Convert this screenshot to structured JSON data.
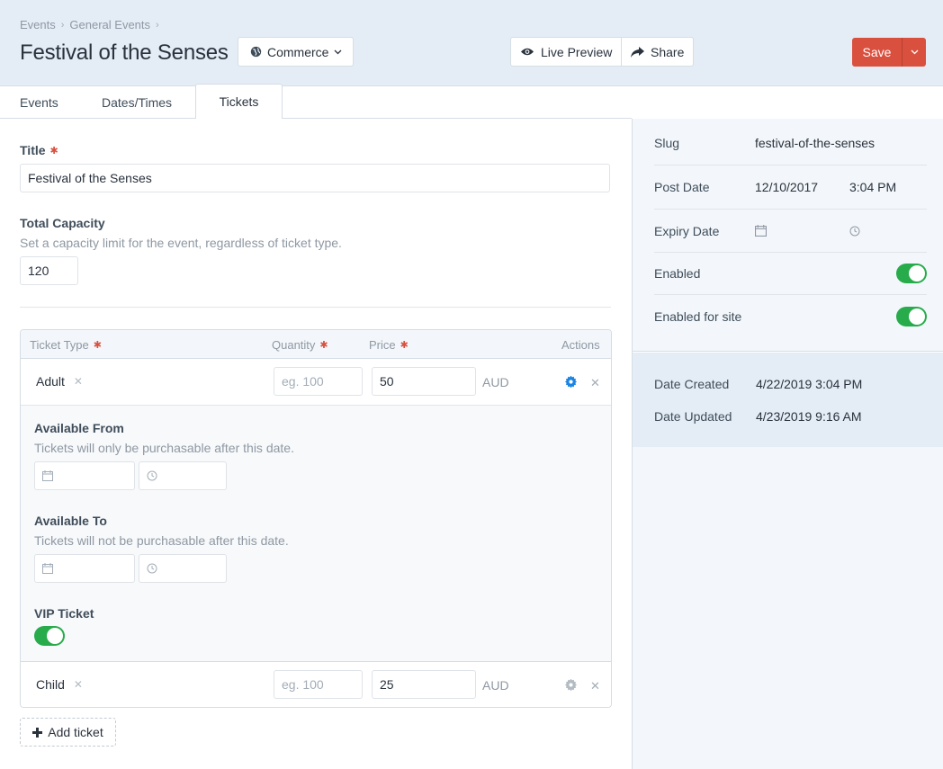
{
  "breadcrumbs": [
    "Events",
    "General Events"
  ],
  "page_title": "Festival of the Senses",
  "header": {
    "commerce_label": "Commerce",
    "live_preview_label": "Live Preview",
    "share_label": "Share",
    "save_label": "Save"
  },
  "tabs": [
    {
      "label": "Events",
      "active": false
    },
    {
      "label": "Dates/Times",
      "active": false
    },
    {
      "label": "Tickets",
      "active": true
    }
  ],
  "form": {
    "title_label": "Title",
    "title_value": "Festival of the Senses",
    "capacity_label": "Total Capacity",
    "capacity_hint": "Set a capacity limit for the event, regardless of ticket type.",
    "capacity_value": "120"
  },
  "tickets_table": {
    "columns": {
      "type": "Ticket Type",
      "quantity": "Quantity",
      "price": "Price",
      "actions": "Actions"
    },
    "rows": [
      {
        "name": "Adult",
        "quantity_placeholder": "eg. 100",
        "price": "50",
        "currency": "AUD",
        "expanded": true
      },
      {
        "name": "Child",
        "quantity_placeholder": "eg. 100",
        "price": "25",
        "currency": "AUD",
        "expanded": false
      }
    ],
    "details": {
      "available_from_label": "Available From",
      "available_from_hint": "Tickets will only be purchasable after this date.",
      "available_to_label": "Available To",
      "available_to_hint": "Tickets will not be purchasable after this date.",
      "vip_label": "VIP Ticket",
      "vip_enabled": true
    },
    "add_label": "Add ticket"
  },
  "sidebar": {
    "slug_label": "Slug",
    "slug_value": "festival-of-the-senses",
    "post_date_label": "Post Date",
    "post_date_value": "12/10/2017",
    "post_time_value": "3:04 PM",
    "expiry_date_label": "Expiry Date",
    "enabled_label": "Enabled",
    "enabled": true,
    "enabled_site_label": "Enabled for site",
    "enabled_site": true,
    "date_created_label": "Date Created",
    "date_created_value": "4/22/2019 3:04 PM",
    "date_updated_label": "Date Updated",
    "date_updated_value": "4/23/2019 9:16 AM"
  },
  "colors": {
    "accent_red": "#d9503f",
    "toggle_green": "#27ab4b",
    "gear_blue": "#1b84e3"
  }
}
